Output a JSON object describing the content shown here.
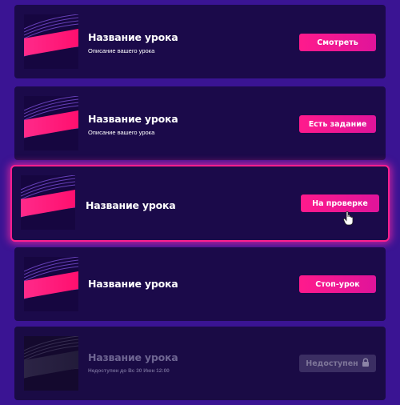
{
  "lessons": [
    {
      "title": "Название урока",
      "description": "Описание вашего урока",
      "button": "Смотреть"
    },
    {
      "title": "Название урока",
      "description": "Описание вашего урока",
      "button": "Есть задание"
    },
    {
      "title": "Название урока",
      "description": "",
      "button": "На проверке"
    },
    {
      "title": "Название урока",
      "description": "",
      "button": "Стоп-урок"
    },
    {
      "title": "Название урока",
      "description": "Недоступен до Вс 30 Июн 12:00",
      "button": "Недоступен"
    }
  ],
  "icons": {
    "lock": "lock-icon",
    "cursor": "hand-pointer-icon"
  },
  "colors": {
    "background": "#3a1493",
    "card": "#1b0a4a",
    "accent": "#ff1a8c",
    "disabled_button": "#3b2e63"
  }
}
